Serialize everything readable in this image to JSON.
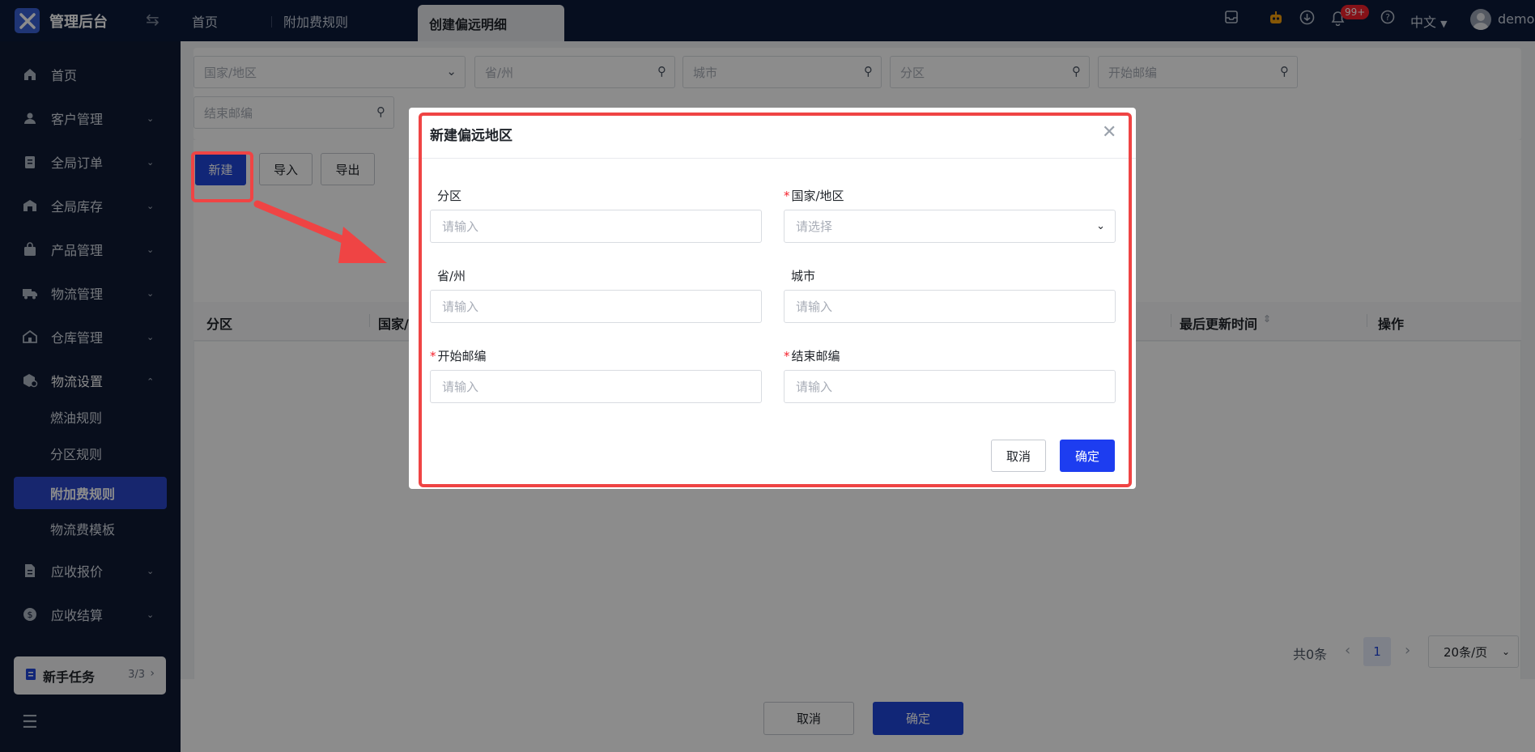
{
  "app": {
    "name": "管理后台"
  },
  "tabs": [
    {
      "label": "首页"
    },
    {
      "label": "附加费规则"
    },
    {
      "label": "创建偏远明细"
    }
  ],
  "header": {
    "badge": "99+",
    "language": "中文",
    "user": "demo"
  },
  "sidebar": {
    "items": [
      {
        "label": "首页",
        "icon": "home-icon"
      },
      {
        "label": "客户管理",
        "icon": "users-icon"
      },
      {
        "label": "全局订单",
        "icon": "clipboard-icon"
      },
      {
        "label": "全局库存",
        "icon": "warehouse-icon"
      },
      {
        "label": "产品管理",
        "icon": "bag-icon"
      },
      {
        "label": "物流管理",
        "icon": "truck-icon"
      },
      {
        "label": "仓库管理",
        "icon": "store-icon"
      },
      {
        "label": "物流设置",
        "icon": "cube-settings-icon"
      }
    ],
    "sub_items": [
      {
        "label": "燃油规则"
      },
      {
        "label": "分区规则"
      },
      {
        "label": "附加费规则"
      },
      {
        "label": "物流费模板"
      }
    ],
    "items_after": [
      {
        "label": "应收报价",
        "icon": "document-icon"
      },
      {
        "label": "应收结算",
        "icon": "coin-icon"
      }
    ],
    "task": {
      "label": "新手任务",
      "count": "3/3"
    }
  },
  "filters": {
    "country": "国家/地区",
    "province": "省/州",
    "city": "城市",
    "zone": "分区",
    "start_zip": "开始邮编",
    "end_zip": "结束邮编"
  },
  "toolbar": {
    "new": "新建",
    "import": "导入",
    "export": "导出"
  },
  "table": {
    "columns": {
      "zone": "分区",
      "country": "国家/",
      "updated": "最后更新时间",
      "actions": "操作"
    }
  },
  "pager": {
    "total": "共0条",
    "page": "1",
    "page_size": "20条/页"
  },
  "footer": {
    "cancel": "取消",
    "confirm": "确定"
  },
  "modal": {
    "title": "新建偏远地区",
    "fields": {
      "zone": {
        "label": "分区",
        "placeholder": "请输入"
      },
      "country": {
        "label": "国家/地区",
        "placeholder": "请选择"
      },
      "province": {
        "label": "省/州",
        "placeholder": "请输入"
      },
      "city": {
        "label": "城市",
        "placeholder": "请输入"
      },
      "start_zip": {
        "label": "开始邮编",
        "placeholder": "请输入"
      },
      "end_zip": {
        "label": "结束邮编",
        "placeholder": "请输入"
      }
    },
    "cancel": "取消",
    "confirm": "确定"
  },
  "colors": {
    "primary": "#2046d9",
    "modal_confirm": "#1d3df0",
    "annotation": "#ef4444",
    "sidebar_bg": "#0f1a33"
  }
}
